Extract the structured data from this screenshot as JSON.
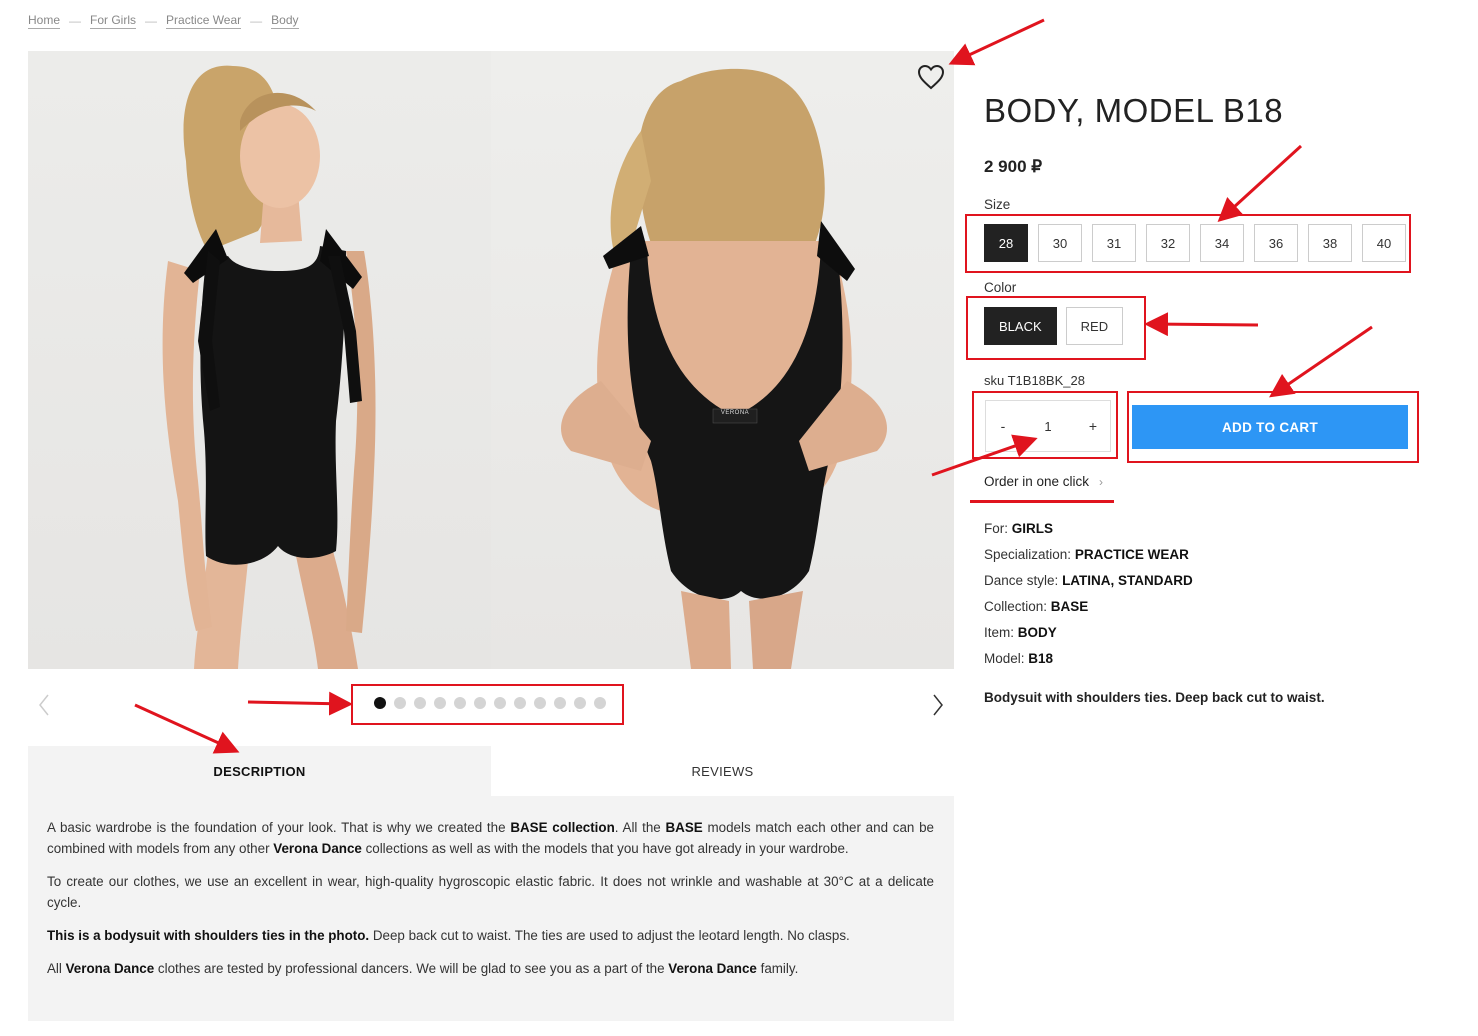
{
  "breadcrumb": [
    "Home",
    "For Girls",
    "Practice Wear",
    "Body"
  ],
  "breadcrumb_separator": "—",
  "product": {
    "title": "BODY, MODEL B18",
    "price": "2 900 ₽",
    "size_label": "Size",
    "sizes": [
      "28",
      "30",
      "31",
      "32",
      "34",
      "36",
      "38",
      "40"
    ],
    "selected_size": "28",
    "color_label": "Color",
    "colors": [
      "BLACK",
      "RED"
    ],
    "selected_color": "BLACK",
    "sku": "sku T1B18BK_28",
    "quantity": "1",
    "qty_minus": "-",
    "qty_plus": "+",
    "add_to_cart": "ADD TO CART",
    "one_click": "Order in one click",
    "specs": [
      {
        "label": "For:",
        "value": "GIRLS"
      },
      {
        "label": "Specialization:",
        "value": "PRACTICE WEAR"
      },
      {
        "label": "Dance style:",
        "value": "LATINA, STANDARD"
      },
      {
        "label": "Collection:",
        "value": "BASE"
      },
      {
        "label": "Item:",
        "value": "BODY"
      },
      {
        "label": "Model:",
        "value": "B18"
      }
    ],
    "short_description": "Bodysuit with shoulders ties. Deep back cut to waist."
  },
  "gallery": {
    "dot_count": 12,
    "active_dot": 0,
    "label_tag": "VERONA"
  },
  "tabs": {
    "description": "DESCRIPTION",
    "reviews": "REVIEWS"
  },
  "description": {
    "p1": [
      {
        "t": "A basic wardrobe is the foundation of your look. That is why we created the ",
        "b": false
      },
      {
        "t": "BASE collection",
        "b": true
      },
      {
        "t": ". All the ",
        "b": false
      },
      {
        "t": "BASE",
        "b": true
      },
      {
        "t": " models match each other and can be combined with models from any other ",
        "b": false
      },
      {
        "t": "Verona Dance",
        "b": true
      },
      {
        "t": " collections as well as with the models that you have got already in your wardrobe.",
        "b": false
      }
    ],
    "p2": [
      {
        "t": "To create our clothes, we use an excellent in wear, high-quality hygroscopic elastic fabric. It does not wrinkle and washable at 30°C at a delicate cycle.",
        "b": false
      }
    ],
    "p3": [
      {
        "t": "This is a bodysuit with shoulders ties in the photo.",
        "b": true
      },
      {
        "t": " Deep back cut to waist. The ties are used to adjust the leotard length. No clasps.",
        "b": false
      }
    ],
    "p4": [
      {
        "t": "All ",
        "b": false
      },
      {
        "t": "Verona Dance",
        "b": true
      },
      {
        "t": " clothes are tested by professional dancers. We will be glad to see you as a part of the ",
        "b": false
      },
      {
        "t": "Verona Dance",
        "b": true
      },
      {
        "t": " family.",
        "b": false
      }
    ]
  },
  "colors": {
    "accent_blue": "#2d96f5",
    "selected_dark": "#222222",
    "annotation_red": "#e0141e",
    "panel_gray": "#f3f3f3"
  }
}
